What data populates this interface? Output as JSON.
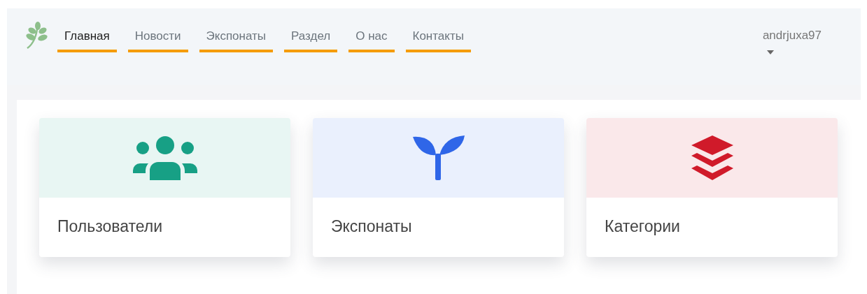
{
  "nav": {
    "items": [
      {
        "label": "Главная",
        "selected": true
      },
      {
        "label": "Новости",
        "selected": false
      },
      {
        "label": "Экспонаты",
        "selected": false
      },
      {
        "label": "Раздел",
        "selected": false
      },
      {
        "label": "О нас",
        "selected": false
      },
      {
        "label": "Контакты",
        "selected": false
      }
    ],
    "user": {
      "name": "andrjuxa97"
    }
  },
  "cards": [
    {
      "title": "Пользователи",
      "kind": "users",
      "color": "#17a085"
    },
    {
      "title": "Экспонаты",
      "kind": "seedling",
      "color": "#2f66e8"
    },
    {
      "title": "Категории",
      "kind": "layers",
      "color": "#d01a2a"
    }
  ]
}
